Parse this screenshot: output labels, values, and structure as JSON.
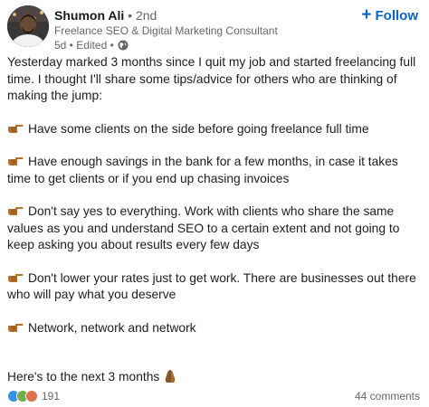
{
  "author": {
    "name": "Shumon Ali",
    "degree": "• 2nd",
    "headline": "Freelance SEO & Digital Marketing Consultant",
    "time": "5d • Edited •"
  },
  "follow": {
    "label": "Follow",
    "icon": "plus-icon",
    "color": "#0a66c2"
  },
  "post": {
    "intro": "Yesterday marked 3 months since I quit my job and started freelancing full time. I thought I'll share some tips/advice for others who are thinking of making the jump:",
    "tips": [
      "Have some clients on the side before going freelance full time",
      "Have enough savings in the bank for a few months, in case it takes time to get clients or if you end up chasing invoices",
      "Don't say yes to everything. Work with clients who share the same values as you and understand SEO to a certain extent and not going to keep asking you about results every few days",
      "Don't lower your rates just to get work. There are businesses out there who will pay what you deserve",
      "Network, network and network"
    ],
    "outro": "Here's to the next 3 months",
    "bullet_icon": "pointing-finger-icon",
    "outro_icon": "praying-hands-icon"
  },
  "social": {
    "reaction_icons": [
      "like-icon",
      "celebrate-icon",
      "love-icon"
    ],
    "reaction_count": "191",
    "comments": "44 comments"
  }
}
